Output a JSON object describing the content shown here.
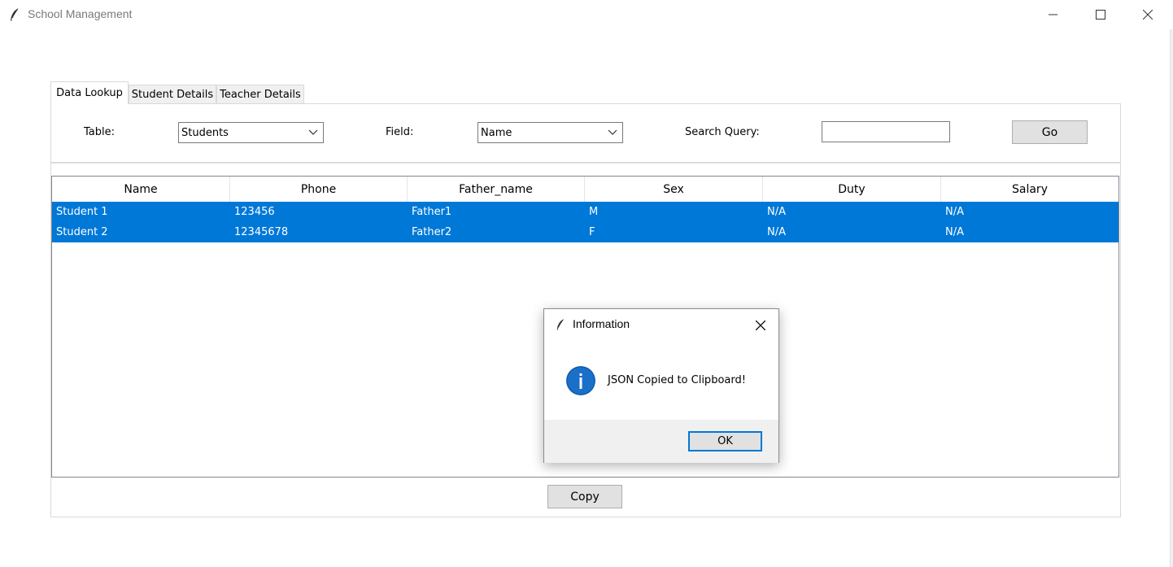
{
  "window": {
    "title": "School Management",
    "icon": "feather-icon"
  },
  "tabs": [
    {
      "label": "Data Lookup",
      "active": true
    },
    {
      "label": "Student Details",
      "active": false
    },
    {
      "label": "Teacher Details",
      "active": false
    }
  ],
  "search": {
    "table_label": "Table:",
    "table_value": "Students",
    "field_label": "Field:",
    "field_value": "Name",
    "query_label": "Search Query:",
    "query_value": "",
    "go_label": "Go"
  },
  "table": {
    "columns": [
      "Name",
      "Phone",
      "Father_name",
      "Sex",
      "Duty",
      "Salary"
    ],
    "rows": [
      [
        "Student 1",
        "123456",
        "Father1",
        "M",
        "N/A",
        "N/A"
      ],
      [
        "Student 2",
        "12345678",
        "Father2",
        "F",
        "N/A",
        "N/A"
      ]
    ],
    "selection_color": "#0078d7"
  },
  "copy_label": "Copy",
  "dialog": {
    "title": "Information",
    "icon": "info-icon",
    "message": "JSON Copied to Clipboard!",
    "ok_label": "OK"
  }
}
